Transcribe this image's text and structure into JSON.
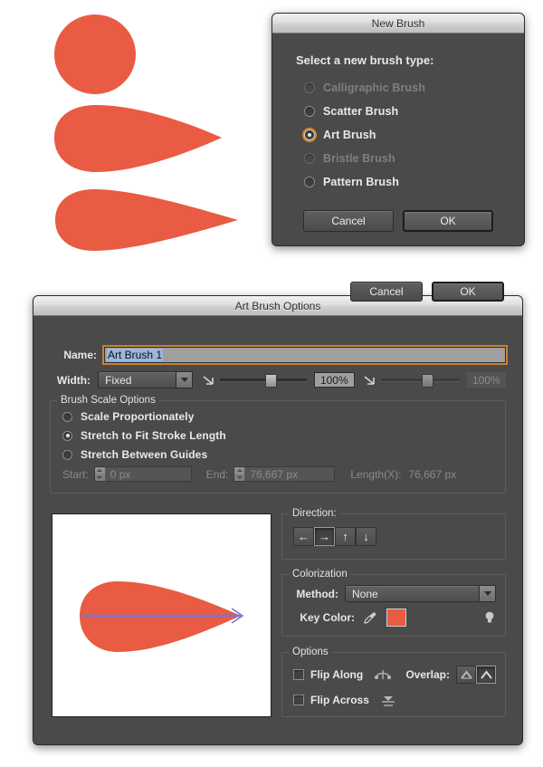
{
  "colors": {
    "artwork_coral": "#E95B42",
    "dialog_bg": "#4A4A4A",
    "focus_orange": "#D6882C",
    "selection_blue": "#9AB7E0",
    "preview_arrow": "#7B74D6",
    "key_color_swatch": "#E95B42"
  },
  "artwork": {
    "shapes": [
      {
        "name": "circle-shape",
        "type": "circle"
      },
      {
        "name": "blunt-teardrop-shape",
        "type": "teardrop-blunt"
      },
      {
        "name": "sharp-teardrop-shape",
        "type": "teardrop-sharp"
      }
    ]
  },
  "new_brush_dialog": {
    "title": "New Brush",
    "prompt": "Select a new brush type:",
    "options": [
      {
        "label": "Calligraphic Brush",
        "selected": false,
        "disabled": true
      },
      {
        "label": "Scatter Brush",
        "selected": false,
        "disabled": false
      },
      {
        "label": "Art Brush",
        "selected": true,
        "disabled": false
      },
      {
        "label": "Bristle Brush",
        "selected": false,
        "disabled": true
      },
      {
        "label": "Pattern Brush",
        "selected": false,
        "disabled": false
      }
    ],
    "cancel_label": "Cancel",
    "ok_label": "OK"
  },
  "art_brush_options": {
    "title": "Art Brush Options",
    "name_label": "Name:",
    "name_value": "Art Brush 1",
    "width_label": "Width:",
    "width_value": "Fixed",
    "width_percent_1": "100%",
    "width_percent_2": "100%",
    "scale": {
      "legend": "Brush Scale Options",
      "options": [
        {
          "label": "Scale Proportionately",
          "selected": false
        },
        {
          "label": "Stretch to Fit Stroke Length",
          "selected": true
        },
        {
          "label": "Stretch Between Guides",
          "selected": false
        }
      ],
      "start_label": "Start:",
      "start_value": "0 px",
      "end_label": "End:",
      "end_value": "76,667 px",
      "length_label": "Length(X):",
      "length_value": "76,667 px"
    },
    "direction": {
      "legend": "Direction:",
      "buttons": [
        {
          "name": "direction-left",
          "glyph": "←",
          "selected": false
        },
        {
          "name": "direction-right",
          "glyph": "→",
          "selected": true
        },
        {
          "name": "direction-up",
          "glyph": "↑",
          "selected": false
        },
        {
          "name": "direction-down",
          "glyph": "↓",
          "selected": false
        }
      ]
    },
    "colorization": {
      "legend": "Colorization",
      "method_label": "Method:",
      "method_value": "None",
      "key_color_label": "Key Color:",
      "eyedropper_icon": "eyedropper-icon",
      "tip_icon": "lightbulb-icon"
    },
    "options": {
      "legend": "Options",
      "flip_along_label": "Flip Along",
      "flip_along_checked": false,
      "flip_across_label": "Flip Across",
      "flip_across_checked": false,
      "overlap_label": "Overlap:",
      "overlap_buttons": [
        {
          "name": "overlap-allow",
          "selected": false
        },
        {
          "name": "overlap-prevent",
          "selected": true
        }
      ]
    },
    "cancel_label": "Cancel",
    "ok_label": "OK"
  }
}
